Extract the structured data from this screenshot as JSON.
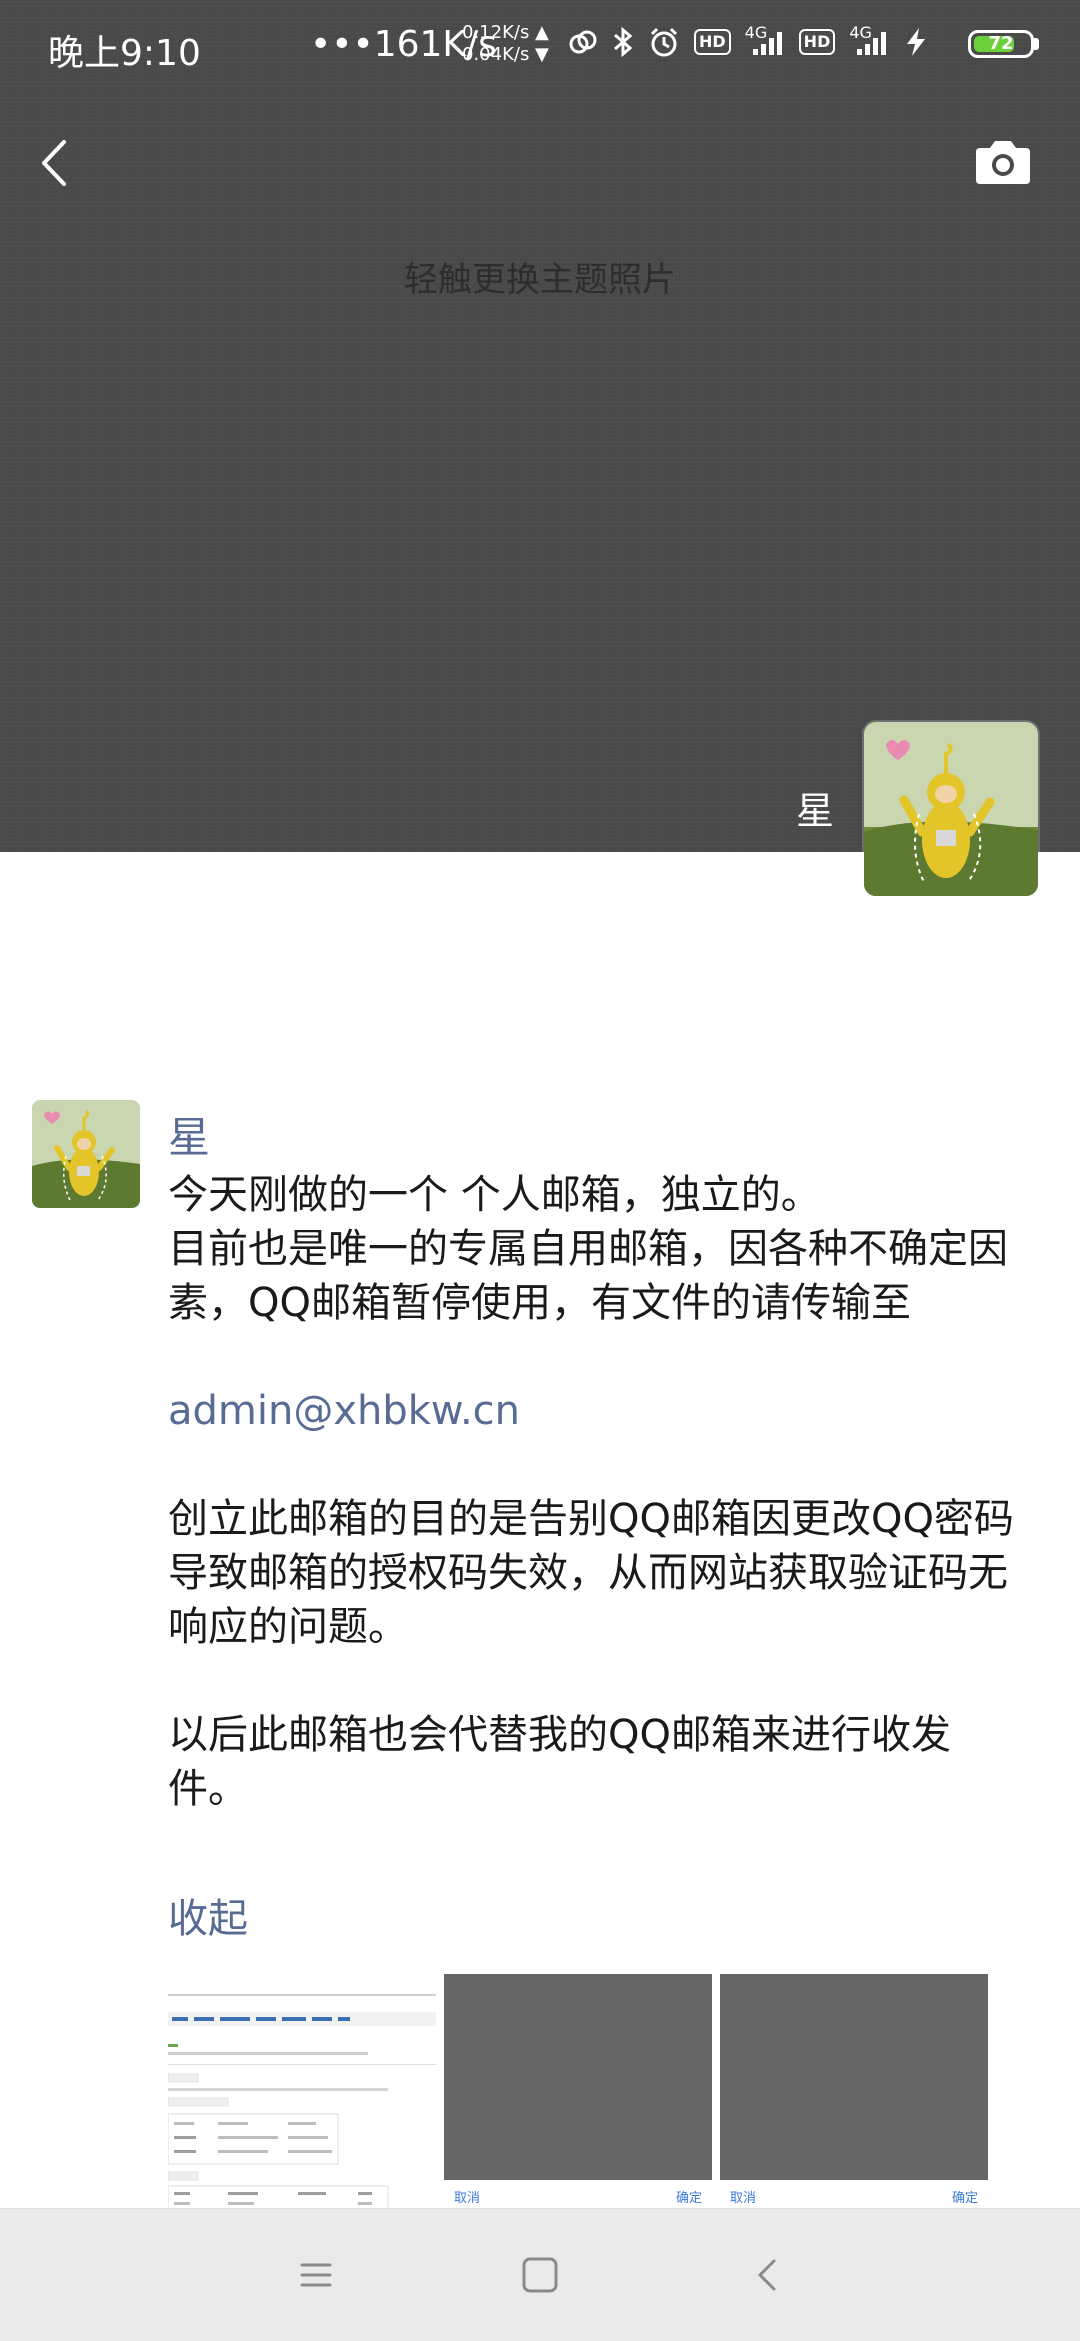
{
  "status_bar": {
    "time": "晚上9:10",
    "net_speed": "•••161K/s",
    "upload_speed": "0.12K/s ▲",
    "download_speed": "0.04K/s ▼",
    "network_1": "4G",
    "network_2": "4G",
    "hd_1": "HD",
    "hd_2": "HD",
    "battery_level": "72",
    "battery_color": "#6bd13a"
  },
  "cover": {
    "hint": "轻触更换主题照片",
    "name": "星",
    "background_color": "#4a4a4a"
  },
  "post": {
    "author": "星",
    "line1": "今天刚做的一个 个人邮箱，独立的。",
    "line2": "目前也是唯一的专属自用邮箱，因各种不确定因素，QQ邮箱暂停使用，有文件的请传输至",
    "email": "admin@xhbkw.cn",
    "paragraph2": "创立此邮箱的目的是告别QQ邮箱因更改QQ密码导致邮箱的授权码失效，从而网站获取验证码无响应的问题。",
    "paragraph3": "以后此邮箱也会代替我的QQ邮箱来进行收发件。",
    "collapse_label": "收起",
    "link_color": "#576b95"
  },
  "thumbnails": [
    {
      "kind": "document-screenshot"
    },
    {
      "kind": "dialog-screenshot",
      "cancel_label": "取消",
      "ok_label": "确定"
    },
    {
      "kind": "dialog-screenshot",
      "cancel_label": "取消",
      "ok_label": "确定"
    }
  ],
  "nav_bar": {
    "icons": [
      "menu-icon",
      "home-square-icon",
      "back-chevron-icon"
    ]
  }
}
